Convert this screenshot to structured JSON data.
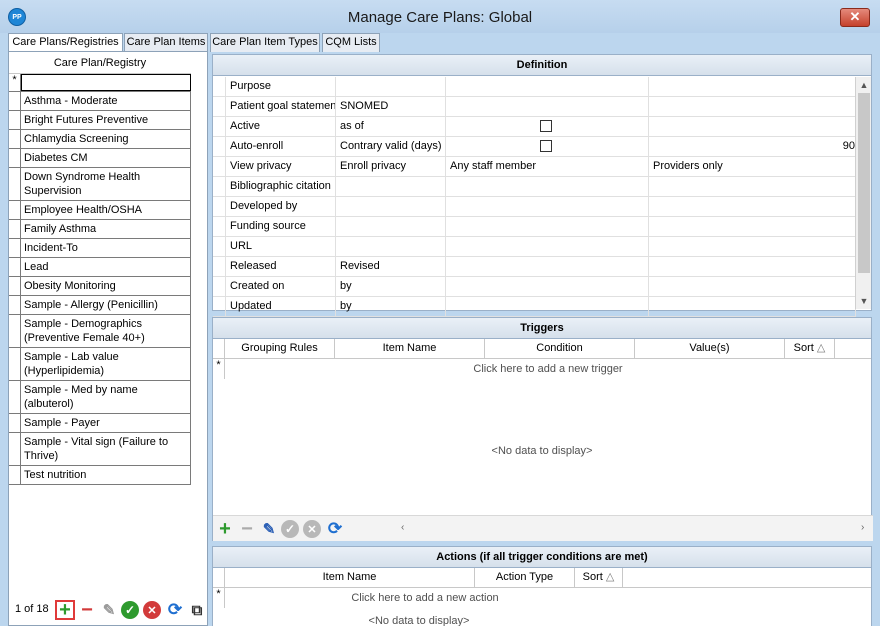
{
  "window": {
    "title": "Manage Care Plans: Global",
    "app_icon_text": "PP",
    "close_glyph": "✕"
  },
  "tabs": [
    {
      "label": "Care Plans/Registries",
      "active": true
    },
    {
      "label": "Care Plan Items",
      "active": false
    },
    {
      "label": "Care Plan Item Types",
      "active": false
    },
    {
      "label": "CQM Lists",
      "active": false
    }
  ],
  "care_plans": {
    "header": "Care Plan/Registry",
    "new_row_indicator": "*",
    "items": [
      "Asthma - Moderate",
      "Bright Futures Preventive",
      "Chlamydia Screening",
      "Diabetes CM",
      "Down Syndrome Health Supervision",
      "Employee Health/OSHA",
      "Family Asthma",
      "Incident-To",
      "Lead",
      "Obesity Monitoring",
      "Sample - Allergy (Penicillin)",
      "Sample - Demographics (Preventive Female 40+)",
      "Sample - Lab value (Hyperlipidemia)",
      "Sample - Med by name (albuterol)",
      "Sample - Payer",
      "Sample - Vital sign (Failure to Thrive)",
      "Test nutrition"
    ],
    "pager": "1 of 18"
  },
  "definition": {
    "header": "Definition",
    "rows": [
      {
        "c1": "Purpose",
        "c2": "",
        "c3": "",
        "c4": ""
      },
      {
        "c1": "Patient goal statement",
        "c2": "SNOMED",
        "c3": "",
        "c4": ""
      },
      {
        "c1": "Active",
        "c2": "as of",
        "c3": "checkbox",
        "c4": ""
      },
      {
        "c1": "Auto-enroll",
        "c2": "Contrary valid (days)",
        "c3": "checkbox",
        "c4": "90"
      },
      {
        "c1": "View privacy",
        "c2": "Enroll privacy",
        "c3": "Any staff member",
        "c4": "Providers only"
      },
      {
        "c1": "Bibliographic citation",
        "c2": "",
        "c3": "",
        "c4": ""
      },
      {
        "c1": "Developed by",
        "c2": "",
        "c3": "",
        "c4": ""
      },
      {
        "c1": "Funding source",
        "c2": "",
        "c3": "",
        "c4": ""
      },
      {
        "c1": "URL",
        "c2": "",
        "c3": "",
        "c4": ""
      },
      {
        "c1": "Released",
        "c2": "Revised",
        "c3": "",
        "c4": ""
      },
      {
        "c1": "Created on",
        "c2": "by",
        "c3": "",
        "c4": ""
      },
      {
        "c1": "Updated",
        "c2": "by",
        "c3": "",
        "c4": ""
      }
    ]
  },
  "triggers": {
    "header": "Triggers",
    "columns": [
      "Grouping Rules",
      "Item Name",
      "Condition",
      "Value(s)",
      "Sort"
    ],
    "sort_glyph": "△",
    "new_row_hint": "Click here to add a new trigger",
    "no_data": "<No data to display>"
  },
  "actions": {
    "header": "Actions (if all trigger conditions are met)",
    "columns": [
      "Item Name",
      "Action Type",
      "Sort"
    ],
    "sort_glyph": "△",
    "new_row_hint": "Click here to add a new action",
    "no_data": "<No data to display>"
  },
  "icons": {
    "add": "+",
    "remove": "−",
    "edit": "✎",
    "accept": "✓",
    "cancel": "✕",
    "refresh": "⟳",
    "copy": "⧉",
    "scroll_up": "▲",
    "scroll_down": "▼",
    "scroll_left": "‹",
    "scroll_right": "›"
  },
  "colors": {
    "accent": "#1f86d6",
    "add_green": "#2e9a2e",
    "remove_red": "#d23a3a",
    "highlight": "#e03a3a"
  }
}
